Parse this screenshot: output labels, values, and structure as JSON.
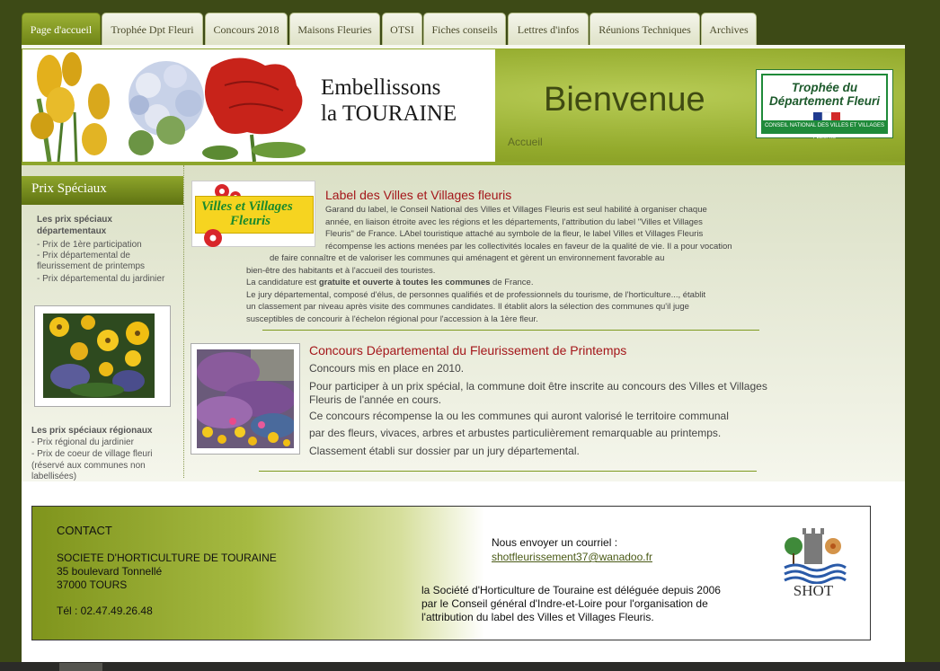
{
  "nav": {
    "tabs": [
      {
        "label": "Page d'accueil",
        "active": true
      },
      {
        "label": "Trophée Dpt Fleuri"
      },
      {
        "label": "Concours 2018"
      },
      {
        "label": "Maisons Fleuries"
      },
      {
        "label": "OTSI"
      },
      {
        "label": "Fiches conseils"
      },
      {
        "label": "Lettres d'infos"
      },
      {
        "label": "Réunions Techniques"
      },
      {
        "label": "Archives"
      }
    ]
  },
  "header": {
    "banner_line1": "Embellissons",
    "banner_line2": "la TOURAINE",
    "welcome": "Bienvenue",
    "breadcrumb": "Accueil",
    "trophy_line1": "Trophée du",
    "trophy_line2": "Département Fleuri",
    "trophy_footer": "CONSEIL NATIONAL DES VILLES ET VILLAGES FLEURIS"
  },
  "sidebar": {
    "title": "Prix Spéciaux",
    "dept_heading_1": "Les prix spéciaux",
    "dept_heading_2": "départementaux",
    "dept_links": [
      "- Prix de 1ère participation",
      "- Prix départemental de",
      "fleurissement de printemps",
      "- Prix départemental du jardinier"
    ],
    "regional_heading": "Les prix spéciaux régionaux",
    "regional_links": [
      "- Prix régional du jardinier",
      "- Prix de coeur de village fleuri",
      "(réservé aux communes non",
      "labellisées)"
    ]
  },
  "article1": {
    "logo_line1": "Villes et Villages",
    "logo_line2": "Fleuris",
    "title": "Label des Villes et Villages fleuris",
    "lines": [
      "Garand du label, le Conseil National des Villes et Villages Fleuris est seul habilité à organiser chaque",
      "année, en liaison étroite avec les régions et les départements, l'attribution du label \"Villes et Villages",
      "Fleuris\" de France. LAbel touristique attaché au symbole de la fleur, le label Villes et Villages Fleuris",
      "récompense les actions menées par les collectivités locales en faveur de la qualité de vie. Il a pour vocation",
      "de faire connaître et de valoriser les communes qui aménagent et gèrent un environnement favorable au",
      "bien-être des habitants et à l'accueil des touristes."
    ],
    "cand_pre": "La candidature est ",
    "cand_bold": "gratuite et ouverte à toutes les communes",
    "cand_post": " de France.",
    "lines2": [
      "Le jury départemental, composé d'élus, de personnes qualifiés et de professionnels du tourisme, de l'horticulture..., établit",
      "un classement par niveau après visite des communes candidates. Il établit alors la sélection des communes qu'il juge",
      "susceptibles de concourir à l'échelon régional pour l'accession à la 1ère fleur."
    ]
  },
  "article2": {
    "title": "Concours Départemental du Fleurissement de Printemps",
    "lines": [
      "Concours mis en place en 2010.",
      "Pour participer à un prix spécial, la commune doit être inscrite au concours des Villes et Villages",
      "Fleuris de l'année en cours.",
      "Ce concours récompense la ou les communes qui auront valorisé le territoire communal",
      "par des fleurs, vivaces, arbres et arbustes particulièrement remarquable au printemps.",
      "Classement établi sur dossier par un jury départemental."
    ]
  },
  "contact": {
    "title": "CONTACT",
    "org": "SOCIETE D'HORTICULTURE DE TOURAINE",
    "street": "35 boulevard Tonnellé",
    "city": "37000 TOURS",
    "phone": "Tél : 02.47.49.26.48",
    "mail_label": "Nous envoyer un courriel :",
    "email": "shotfleurissement37@wanadoo.fr",
    "delegation": [
      "la Société d'Horticulture de Touraine est déléguée depuis 2006",
      "par le Conseil général d'Indre-et-Loire pour l'organisation de",
      "l'attribution du label des Villes et Villages Fleuris."
    ],
    "logo_text": "SHOT"
  }
}
